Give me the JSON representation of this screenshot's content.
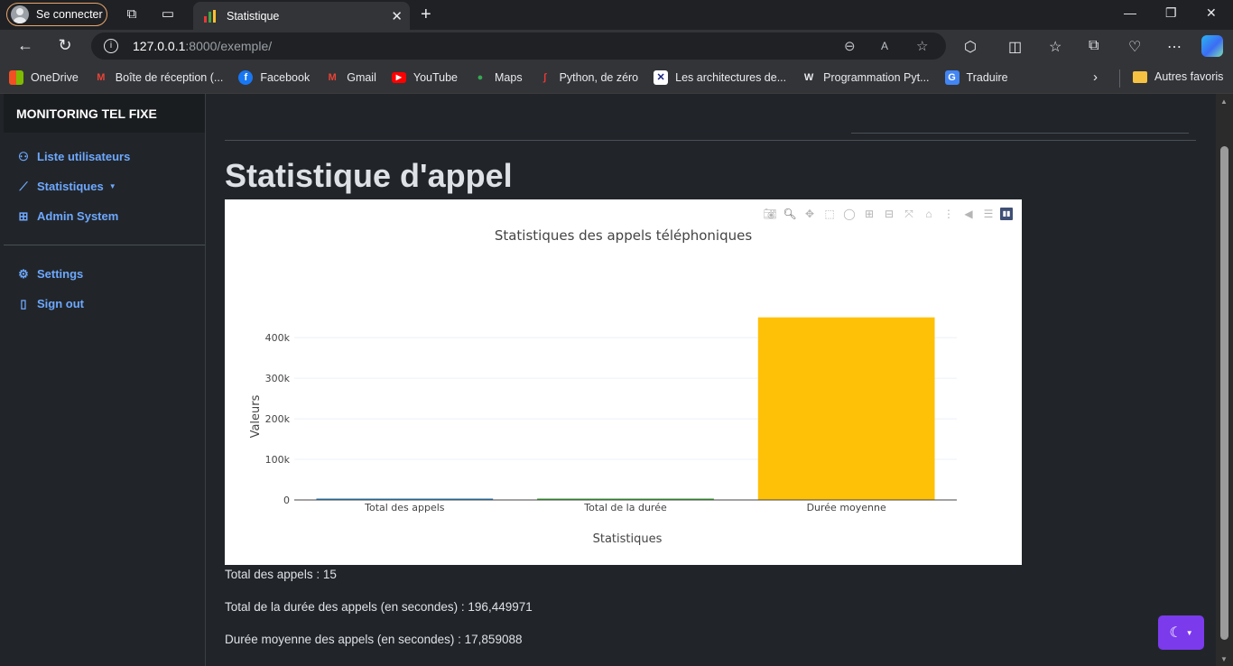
{
  "browser": {
    "profile_label": "Se connecter",
    "tab_title": "Statistique",
    "url_host": "127.0.0.1",
    "url_rest": ":8000/exemple/",
    "bookmarks": [
      {
        "label": "OneDrive",
        "icon": "onedrive-icon"
      },
      {
        "label": "Boîte de réception (...",
        "icon": "gmail-icon"
      },
      {
        "label": "Facebook",
        "icon": "facebook-icon"
      },
      {
        "label": "Gmail",
        "icon": "gmail-icon"
      },
      {
        "label": "YouTube",
        "icon": "youtube-icon"
      },
      {
        "label": "Maps",
        "icon": "maps-icon"
      },
      {
        "label": "Python, de zéro",
        "icon": "python-icon"
      },
      {
        "label": "Les architectures de...",
        "icon": "architectures-icon"
      },
      {
        "label": "Programmation Pyt...",
        "icon": "programmation-icon"
      },
      {
        "label": "Traduire",
        "icon": "translate-icon"
      }
    ],
    "other_bookmarks": "Autres favoris"
  },
  "sidebar": {
    "brand": "MONITORING TEL FIXE",
    "items": [
      {
        "label": "Liste utilisateurs",
        "icon": "users-icon"
      },
      {
        "label": "Statistiques",
        "icon": "chart-icon"
      },
      {
        "label": "Admin System",
        "icon": "cpu-icon"
      }
    ],
    "bottom_items": [
      {
        "label": "Settings",
        "icon": "gear-icon"
      },
      {
        "label": "Sign out",
        "icon": "door-icon"
      }
    ]
  },
  "main": {
    "title": "Statistique d'appel",
    "stats": [
      "Total des appels : 15",
      "Total de la durée des appels (en secondes) : 196,449971",
      "Durée moyenne des appels (en secondes) : 17,859088"
    ]
  },
  "chart_data": {
    "type": "bar",
    "title": "Statistiques des appels téléphoniques",
    "xlabel": "Statistiques",
    "ylabel": "Valeurs",
    "categories": [
      "Total des appels",
      "Total de la durée",
      "Durée moyenne"
    ],
    "values": [
      15,
      196.449971,
      450000
    ],
    "colors": [
      "#1f77b4",
      "#2ca02c",
      "#ffc107"
    ],
    "yticks": [
      0,
      100000,
      200000,
      300000,
      400000
    ],
    "ytick_labels": [
      "0",
      "100k",
      "200k",
      "300k",
      "400k"
    ],
    "ylim": [
      0,
      473684
    ],
    "grid": true
  },
  "colors": {
    "accent": "#6ea8fe",
    "theme_button": "#7c3aed",
    "background": "#212529"
  }
}
